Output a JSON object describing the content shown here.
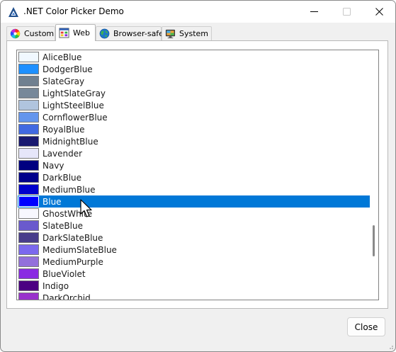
{
  "window": {
    "title": ".NET Color Picker Demo",
    "accent_color": "#0078d7"
  },
  "tabs": [
    {
      "label": "Custom",
      "icon": "color-wheel-icon",
      "active": false
    },
    {
      "label": "Web",
      "icon": "palette-window-icon",
      "active": true
    },
    {
      "label": "Browser-safe",
      "icon": "globe-icon",
      "active": false
    },
    {
      "label": "System",
      "icon": "monitor-icon",
      "active": false
    }
  ],
  "colors": [
    {
      "name": "AliceBlue",
      "hex": "#f0f8ff"
    },
    {
      "name": "DodgerBlue",
      "hex": "#1e90ff"
    },
    {
      "name": "SlateGray",
      "hex": "#708090"
    },
    {
      "name": "LightSlateGray",
      "hex": "#778899"
    },
    {
      "name": "LightSteelBlue",
      "hex": "#b0c4de"
    },
    {
      "name": "CornflowerBlue",
      "hex": "#6495ed"
    },
    {
      "name": "RoyalBlue",
      "hex": "#4169e1"
    },
    {
      "name": "MidnightBlue",
      "hex": "#191970"
    },
    {
      "name": "Lavender",
      "hex": "#e6e6fa"
    },
    {
      "name": "Navy",
      "hex": "#000080"
    },
    {
      "name": "DarkBlue",
      "hex": "#00008b"
    },
    {
      "name": "MediumBlue",
      "hex": "#0000cd"
    },
    {
      "name": "Blue",
      "hex": "#0000ff",
      "selected": true
    },
    {
      "name": "GhostWhite",
      "hex": "#f8f8ff"
    },
    {
      "name": "SlateBlue",
      "hex": "#6a5acd"
    },
    {
      "name": "DarkSlateBlue",
      "hex": "#483d8b"
    },
    {
      "name": "MediumSlateBlue",
      "hex": "#7b68ee"
    },
    {
      "name": "MediumPurple",
      "hex": "#9370db"
    },
    {
      "name": "BlueViolet",
      "hex": "#8a2be2"
    },
    {
      "name": "Indigo",
      "hex": "#4b0082"
    },
    {
      "name": "DarkOrchid",
      "hex": "#9932cc"
    }
  ],
  "buttons": {
    "close_label": "Close"
  }
}
